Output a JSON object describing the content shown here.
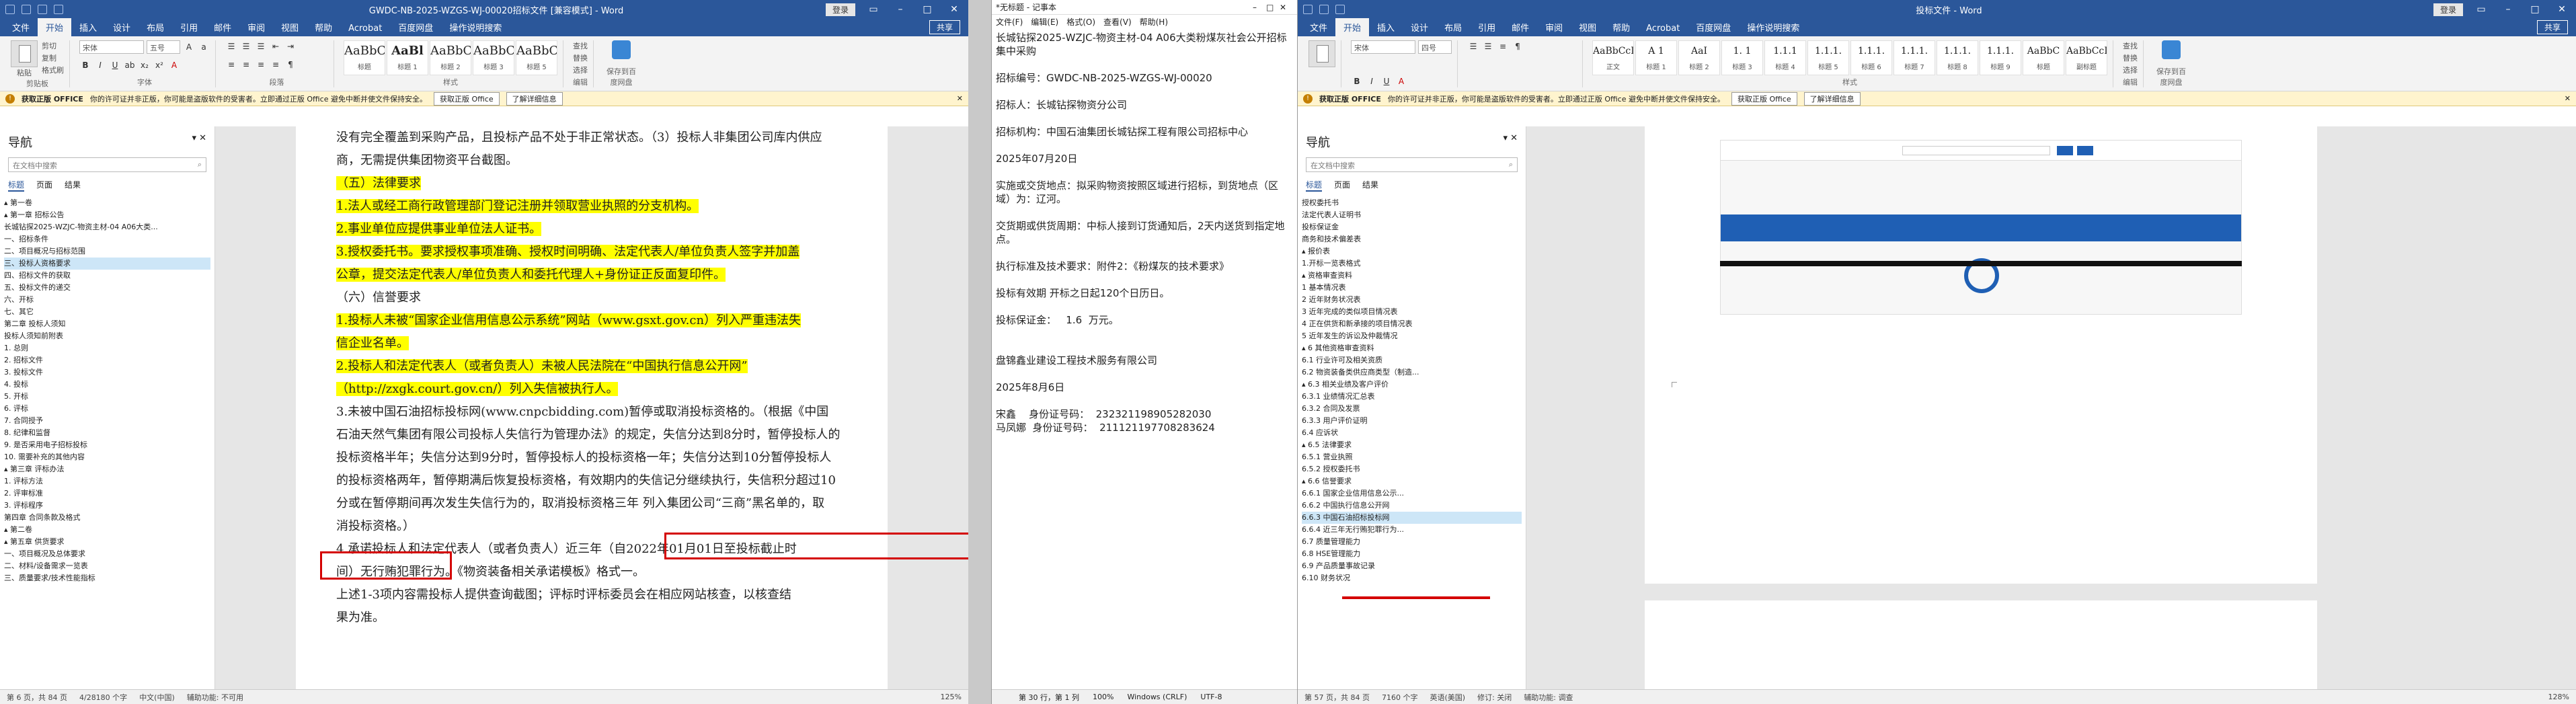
{
  "word1": {
    "title": "GWDC-NB-2025-WZGS-WJ-00020招标文件 [兼容模式] - Word",
    "signin": "登录",
    "tabs": [
      "文件",
      "开始",
      "插入",
      "设计",
      "布局",
      "引用",
      "邮件",
      "审阅",
      "视图",
      "帮助",
      "Acrobat",
      "百度网盘",
      "操作说明搜索"
    ],
    "share": "共享",
    "ribbon": {
      "paste": "粘贴",
      "cut": "剪切",
      "copy": "复制",
      "format_painter": "格式刷",
      "clipboard": "剪贴板",
      "font_name": "宋体",
      "font_size": "五号",
      "font_group": "字体",
      "paragraph_group": "段落",
      "styles_group": "样式",
      "editing_group": "编辑",
      "find": "查找",
      "replace": "替换",
      "select": "选择",
      "save_group": "保存到百度网盘",
      "styles": [
        {
          "preview": "AaBbC",
          "name": "标题"
        },
        {
          "preview": "AaBl",
          "name": "标题 1"
        },
        {
          "preview": "AaBbC",
          "name": "标题 2"
        },
        {
          "preview": "AaBbC",
          "name": "标题 3"
        },
        {
          "preview": "AaBbC",
          "name": "标题 5"
        }
      ]
    },
    "msgbar": {
      "label": "获取正版 OFFICE",
      "text": "你的许可证并非正版，你可能是盗版软件的受害者。立即通过正版 Office 避免中断并使文件保持安全。",
      "btn1": "获取正版 Office",
      "btn2": "了解详细信息"
    },
    "nav": {
      "title": "导航",
      "search_placeholder": "在文档中搜索",
      "tabs": [
        "标题",
        "页面",
        "结果"
      ],
      "items": [
        "▴ 第一卷",
        "  ▴ 第一章 招标公告",
        "    长城钻探2025-WZJC-物资主材-04 A06大类...",
        "    一、招标条件",
        "    二、项目概况与招标范围",
        "    三、投标人资格要求",
        "    四、招标文件的获取",
        "    五、投标文件的递交",
        "    六、开标",
        "    七、其它",
        "  第二章 投标人须知",
        "  投标人须知前附表",
        "    1. 总则",
        "    2. 招标文件",
        "    3. 投标文件",
        "    4. 投标",
        "    5. 开标",
        "    6. 评标",
        "    7. 合同授予",
        "    8. 纪律和监督",
        "    9. 是否采用电子招标投标",
        "    10. 需要补充的其他内容",
        "  ▴ 第三章 评标办法",
        "    1. 评标方法",
        "    2. 评审标准",
        "    3. 评标程序",
        "  第四章 合同条款及格式",
        "▴ 第二卷",
        "  ▴ 第五章 供货要求",
        "    一、项目概况及总体要求",
        "    二、材料/设备需求一览表",
        "    三、质量要求/技术性能指标"
      ],
      "selected": 5
    },
    "doc": {
      "lines": [
        {
          "t": "没有完全覆盖到采购产品，且投标产品不处于非正常状态。（3）投标人非集团公司库内供应",
          "cls": ""
        },
        {
          "t": "商，无需提供集团物资平台截图。",
          "cls": ""
        },
        {
          "t": "（五）法律要求",
          "cls": "hl"
        },
        {
          "t": "1.法人或经工商行政管理部门登记注册并领取营业执照的分支机构。",
          "cls": "hl"
        },
        {
          "t": "2.事业单位应提供事业单位法人证书。",
          "cls": "hl"
        },
        {
          "t": "3.授权委托书。要求授权事项准确、授权时间明确、法定代表人/单位负责人签字并加盖",
          "cls": "hl"
        },
        {
          "t": "公章，提交法定代表人/单位负责人和委托代理人+身份证正反面复印件。",
          "cls": "hl"
        },
        {
          "t": "（六）信誉要求",
          "cls": ""
        },
        {
          "t": "1.投标人未被“国家企业信用信息公示系统”网站（www.gsxt.gov.cn）列入严重违法失",
          "cls": "hl"
        },
        {
          "t": "信企业名单。",
          "cls": "hl"
        },
        {
          "t": "2.投标人和法定代表人（或者负责人）未被人民法院在“中国执行信息公开网”",
          "cls": "hl"
        },
        {
          "t": "（http://zxgk.court.gov.cn/）列入失信被执行人。",
          "cls": "hl"
        },
        {
          "t": "3.未被中国石油招标投标网(www.cnpcbidding.com)暂停或取消投标资格的。（根据《中国",
          "cls": ""
        },
        {
          "t": "石油天然气集团有限公司投标人失信行为管理办法》的规定，失信分达到8分时，暂停投标人的",
          "cls": ""
        },
        {
          "t": "投标资格半年；失信分达到9分时，暂停投标人的投标资格一年；失信分达到10分暂停投标人",
          "cls": ""
        },
        {
          "t": "的投标资格两年，暂停期满后恢复投标资格，有效期内的失信记分继续执行，失信积分超过10",
          "cls": ""
        },
        {
          "t": "分或在暂停期间再次发生失信行为的，取消投标资格三年   列入集团公司“三商”黑名单的，取",
          "cls": ""
        },
        {
          "t": "消投标资格。）",
          "cls": ""
        },
        {
          "t": "4.承诺投标人和法定代表人（或者负责人）近三年（自2022年01月01日至投标截止时",
          "cls": ""
        },
        {
          "t": "间）无行贿犯罪行为。《物资装备相关承诺模板》格式一。",
          "cls": ""
        },
        {
          "t": "上述1-3项内容需投标人提供查询截图；评标时评标委员会在相应网站核查，以核查结",
          "cls": ""
        },
        {
          "t": "果为准。",
          "cls": ""
        }
      ]
    },
    "status": {
      "page": "第 6 页，共 84 页",
      "words": "4/28180 个字",
      "lang": "中文(中国)",
      "mode": "辅助功能: 不可用",
      "zoom": "125%"
    }
  },
  "notepad": {
    "title": "*无标题 - 记事本",
    "menu": [
      "文件(F)",
      "编辑(E)",
      "格式(O)",
      "查看(V)",
      "帮助(H)"
    ],
    "content": "长城钻探2025-WZJC-物资主材-04 A06大类粉煤灰社会公开招标集中采购\n\n招标编号：GWDC-NB-2025-WZGS-WJ-00020\n\n招标人：长城钻探物资分公司\n\n招标机构：中国石油集团长城钻探工程有限公司招标中心\n\n2025年07月20日\n\n实施或交货地点：拟采购物资按照区域进行招标，到货地点（区域）为：辽河。\n\n交货期或供货周期：中标人接到订货通知后，2天内送货到指定地点。\n\n执行标准及技术要求：附件2：《粉煤灰的技术要求》\n\n投标有效期 开标之日起120个日历日。\n\n投标保证金：   1.6  万元。\n\n\n盘锦鑫业建设工程技术服务有限公司\n\n2025年8月6日\n\n宋鑫    身份证号码：  232321198905282030\n马凤娜  身份证号码：  211121197708283624",
    "status": {
      "pos": "第 30 行，第 1 列",
      "zoom": "100%",
      "eol": "Windows (CRLF)",
      "enc": "UTF-8"
    }
  },
  "word2": {
    "title": "投标文件 - Word",
    "signin": "登录",
    "tabs": [
      "文件",
      "开始",
      "插入",
      "设计",
      "布局",
      "引用",
      "邮件",
      "审阅",
      "视图",
      "帮助",
      "Acrobat",
      "百度网盘",
      "操作说明搜索"
    ],
    "share": "共享",
    "ribbon": {
      "font_name": "宋体",
      "font_size": "四号",
      "styles": [
        {
          "preview": "AaBbCcDd",
          "name": "正文"
        },
        {
          "preview": "A 1",
          "name": "标题 1"
        },
        {
          "preview": "AaI",
          "name": "标题 2"
        },
        {
          "preview": "1. 1",
          "name": "标题 3"
        },
        {
          "preview": "1.1.1",
          "name": "标题 4"
        },
        {
          "preview": "1.1.1.",
          "name": "标题 5"
        },
        {
          "preview": "1.1.1.",
          "name": "标题 6"
        },
        {
          "preview": "1.1.1.",
          "name": "标题 7"
        },
        {
          "preview": "1.1.1.",
          "name": "标题 8"
        },
        {
          "preview": "1.1.1.",
          "name": "标题 9"
        },
        {
          "preview": "AaBbC",
          "name": "标题"
        },
        {
          "preview": "AaBbCcDd",
          "name": "副标题"
        }
      ],
      "styles_group": "样式",
      "editing_group": "编辑",
      "find": "查找",
      "replace": "替换",
      "select": "选择",
      "save_group": "保存到百度网盘"
    },
    "msgbar": {
      "label": "获取正版 OFFICE",
      "text": "你的许可证并非正版，你可能是盗版软件的受害者。立即通过正版 Office 避免中断并使文件保持安全。",
      "btn1": "获取正版 Office",
      "btn2": "了解详细信息"
    },
    "nav": {
      "title": "导航",
      "search_placeholder": "在文档中搜索",
      "tabs": [
        "标题",
        "页面",
        "结果"
      ],
      "items": [
        "  授权委托书",
        "  法定代表人证明书",
        "  投标保证金",
        "  商务和技术偏差表",
        "▴ 报价表",
        "    1.开标一览表格式",
        "▴ 资格审查资料",
        "    1 基本情况表",
        "    2 近年财务状况表",
        "    3 近年完成的类似项目情况表",
        "    4 正在供货和新承接的项目情况表",
        "    5 近年发生的诉讼及仲裁情况",
        "  ▴ 6 其他资格审查资料",
        "      6.1 行业许可及相关资质",
        "      6.2 物资装备类供应商类型（制造...",
        "    ▴ 6.3 相关业绩及客户评价",
        "        6.3.1 业绩情况汇总表",
        "        6.3.2 合同及发票",
        "        6.3.3 用户评价证明",
        "      6.4 应诉状",
        "    ▴ 6.5 法律要求",
        "        6.5.1 营业执照",
        "        6.5.2 授权委托书",
        "    ▴ 6.6 信誉要求",
        "        6.6.1 国家企业信用信息公示...",
        "        6.6.2 中国执行信息公开网",
        "        6.6.3 中国石油招标投标网",
        "        6.6.4 近三年无行贿犯罪行为...",
        "      6.7 质量管理能力",
        "      6.8 HSE管理能力",
        "      6.9 产品质量事故记录",
        "      6.10 财务状况"
      ],
      "selected": 26
    },
    "status": {
      "page": "第 57 页，共 84 页",
      "words": "7160 个字",
      "lang": "英语(美国)",
      "track": "修订: 关闭",
      "access": "辅助功能: 调查",
      "zoom": "128%"
    }
  },
  "colors": {
    "word_blue": "#2b579a",
    "highlight": "#ffff00",
    "red_box": "#d40000",
    "msg_bg": "#fff4ce"
  }
}
